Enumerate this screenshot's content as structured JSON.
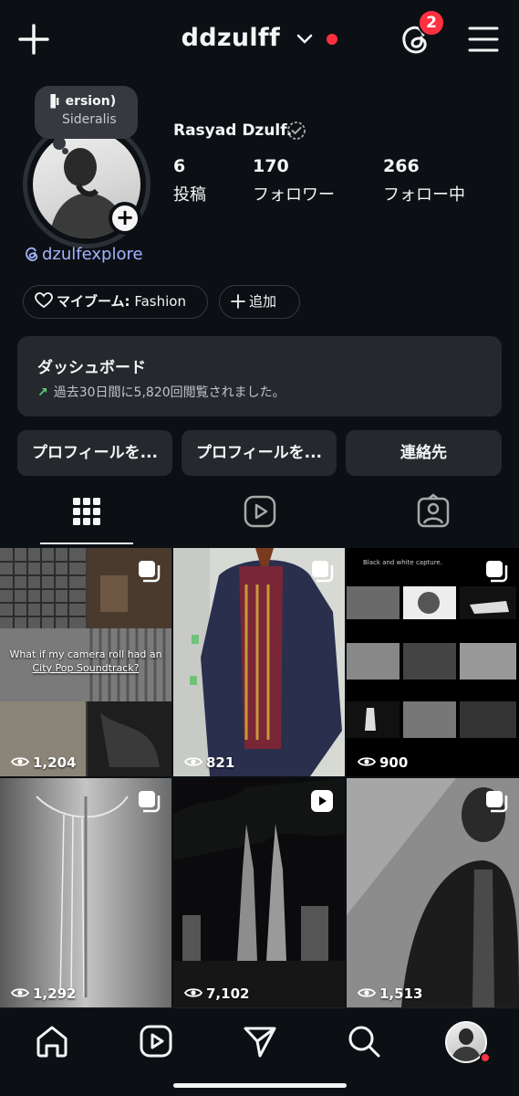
{
  "header": {
    "username": "ddzulff",
    "threads_badge_count": "2"
  },
  "note": {
    "line1": "ersion)",
    "line2": "Sideralis"
  },
  "profile": {
    "full_name": "Rasyad Dzulf.",
    "threads_handle": "dzulfexplore",
    "stats": [
      {
        "value": "6",
        "label": "投稿"
      },
      {
        "value": "170",
        "label": "フォロワー"
      },
      {
        "value": "266",
        "label": "フォロー中"
      }
    ]
  },
  "chips": {
    "my_boom_label": "マイブーム:",
    "my_boom_value": "Fashion",
    "add_label": "追加"
  },
  "dashboard": {
    "title": "ダッシュボード",
    "subtitle": "過去30日間に5,820回閲覧されました。"
  },
  "actions": {
    "edit_profile": "プロフィールを...",
    "share_profile": "プロフィールを...",
    "contact": "連絡先"
  },
  "grid": [
    {
      "views": "1,204",
      "caption_line1": "What if my camera roll had an",
      "caption_line2": "City Pop Soundtrack?"
    },
    {
      "views": "821"
    },
    {
      "views": "900",
      "caption_line1": "Black and white capture."
    },
    {
      "views": "1,292"
    },
    {
      "views": "7,102"
    },
    {
      "views": "1,513"
    }
  ],
  "colors": {
    "background": "#0c1014",
    "card": "#25292e",
    "accent_link": "#a4b3ff",
    "notification_red": "#ff3040",
    "trend_green": "#5fd27a"
  }
}
